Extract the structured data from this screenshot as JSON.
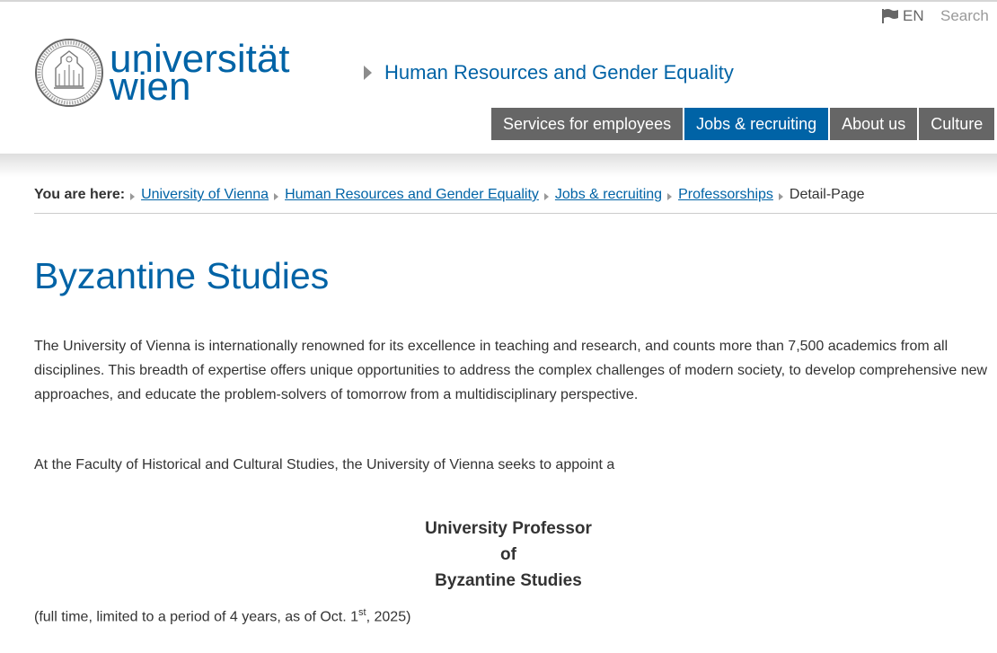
{
  "header": {
    "language": "EN",
    "search_label": "Search",
    "logo_line1": "universität",
    "logo_line2": "wien",
    "department": "Human Resources and Gender Equality",
    "nav": [
      {
        "label": "Services for employees",
        "active": false
      },
      {
        "label": "Jobs & recruiting",
        "active": true
      },
      {
        "label": "About us",
        "active": false
      },
      {
        "label": "Culture",
        "active": false
      }
    ]
  },
  "breadcrumb": {
    "label": "You are here:",
    "links": [
      "University of Vienna",
      "Human Resources and Gender Equality",
      "Jobs & recruiting",
      "Professorships"
    ],
    "current": "Detail-Page"
  },
  "main": {
    "title": "Byzantine Studies",
    "intro": "The University of Vienna is internationally renowned for its excellence in teaching and research, and counts more than 7,500 academics from all disciplines. This breadth of expertise offers unique opportunities to address the complex challenges of modern society, to develop comprehensive new approaches, and educate the problem-solvers of tomorrow from a multidisciplinary perspective.",
    "seeks": "At the Faculty of Historical and Cultural Studies, the University of Vienna seeks to appoint a",
    "position_line1": "University Professor",
    "position_line2": "of",
    "position_line3": "Byzantine Studies",
    "terms_before": "(full time, limited to a period of 4 years, as of Oct. 1",
    "terms_sup": "st",
    "terms_after": ", 2025)"
  },
  "colors": {
    "brand": "#0063a6",
    "nav_bg": "#666666"
  }
}
